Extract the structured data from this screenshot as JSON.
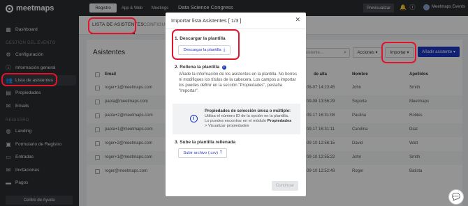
{
  "app": {
    "logo_text": "meetmaps",
    "event_title": "Data Science Congress"
  },
  "topbar": {
    "tabs": [
      "Registro",
      "App & Web",
      "Meetings"
    ],
    "preview_label": "Previsualizar",
    "user_name": "Meetmaps Events"
  },
  "sidebar": {
    "main_items": [
      {
        "label": "Dashboard",
        "icon": "grid-icon"
      },
      {
        "label": "Configuración",
        "icon": "gear-icon"
      },
      {
        "label": "Información general",
        "icon": "info-icon"
      },
      {
        "label": "Lista de asistentes",
        "icon": "people-icon"
      },
      {
        "label": "Propiedades",
        "icon": "tag-icon"
      },
      {
        "label": "Emails",
        "icon": "envelope-icon"
      }
    ],
    "section_event": "GESTIÓN DEL EVENTO",
    "section_registro": "REGISTRO",
    "registro_items": [
      {
        "label": "Landing",
        "icon": "globe-icon"
      },
      {
        "label": "Formulario de Registro",
        "icon": "form-icon"
      },
      {
        "label": "Entradas",
        "icon": "ticket-icon"
      },
      {
        "label": "Invitaciones",
        "icon": "mail-icon"
      },
      {
        "label": "Pagos",
        "icon": "card-icon"
      }
    ],
    "help_label": "Centro de Ayuda"
  },
  "subtabs": {
    "active": "LISTA DE ASISTENTES",
    "inactive": "CONFIGURA"
  },
  "main": {
    "title": "Asistentes",
    "search_placeholder": "asistente...",
    "actions_label": "Acciones",
    "import_label": "Importar",
    "add_label": "Añadir asistente",
    "columns": {
      "email": "Email",
      "date": "de alta",
      "name": "Nombre",
      "surname": "Apellidos"
    },
    "rows": [
      {
        "email": "roger+1@meetmaps.com",
        "date": "08-07 14:23:45",
        "name": "John",
        "surname": "Smith"
      },
      {
        "email": "paola@meetmaps.com",
        "date": "09-08 13:56:29",
        "name": "Soporte",
        "surname": "Meetmaps"
      },
      {
        "email": "paola+2@meetmaps.com",
        "date": "09-17 16:31:08",
        "name": "Paulina",
        "surname": "Robles"
      },
      {
        "email": "paola+1@meetmaps.com",
        "date": "09-17 16:31:11",
        "name": "Carolina",
        "surname": "Diaz"
      },
      {
        "email": "roger+2@meetmaps.com",
        "date": "09-10 12:56:15",
        "name": "David",
        "surname": "Watt"
      },
      {
        "email": "roger+1@meetmaps.com",
        "date": "09-10 12:55:22",
        "name": "John",
        "surname": "Smith"
      },
      {
        "email": "roger@meetmaps.com",
        "date": "09-10 12:52:49",
        "name": "Roger",
        "surname": "Batista"
      }
    ]
  },
  "modal": {
    "title": "Importar lista Asistentes [ 1/3 ]",
    "close": "✕",
    "step1_title": "1. Descargar la plantilla",
    "step1_button": "Descargar la plantilla",
    "step2_title": "2. Rellena la plantilla",
    "step2_text": "Añade la información de los asistentes en la plantilla. No borres ni modifiques los títulos de la cabecera. Los campos a importar los puedes definir en la sección \"Propiedades\", pestaña \"Importar\".",
    "info_title": "Propiedades de selección única o múltiple:",
    "info_line1": "Utiliza el número ID de la opción en la plantilla.",
    "info_line2_pre": "Lo puedes encontrar en el módulo ",
    "info_line2_bold": "Propiedades",
    "info_line3": "> Visualizar propiedades",
    "step3_title": "3. Sube la plantilla rellenada",
    "step3_button": "Subir archivo (.csv)",
    "continue_label": "Continuar"
  },
  "colors": {
    "accent": "#1d37c5",
    "highlight": "#e2142d",
    "sidebar": "#2b2d31"
  }
}
